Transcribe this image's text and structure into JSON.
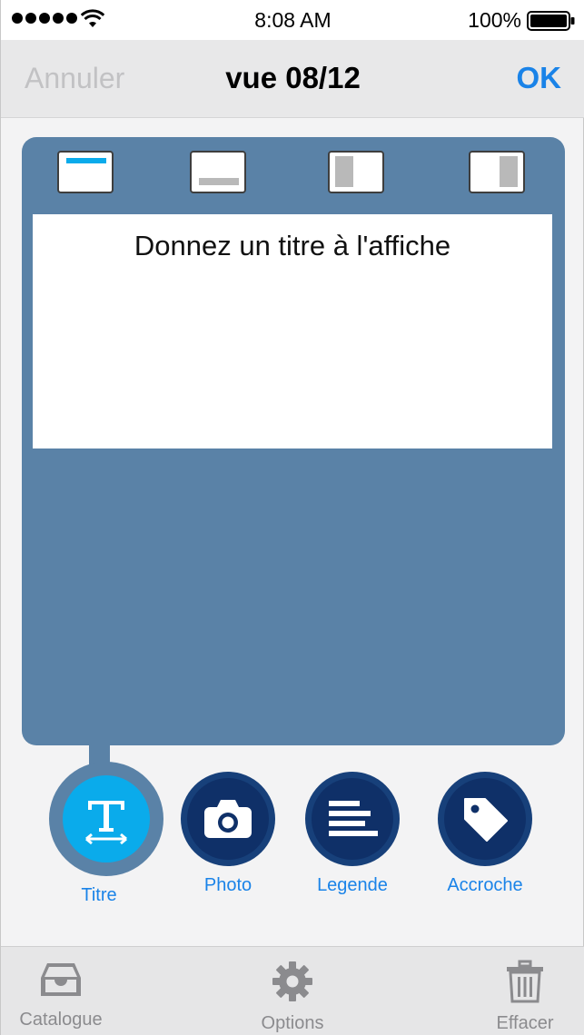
{
  "status_bar": {
    "time": "8:08 AM",
    "battery_percent": "100%",
    "signal_bars": 5,
    "icons": [
      "signal-dots-icon",
      "wifi-icon",
      "battery-icon"
    ]
  },
  "nav": {
    "cancel_label": "Annuler",
    "title": "vue 08/12",
    "ok_label": "OK"
  },
  "layout_options": [
    {
      "name": "layout-title-top-icon",
      "selected": true
    },
    {
      "name": "layout-title-bottom-icon",
      "selected": false
    },
    {
      "name": "layout-photo-left-icon",
      "selected": false
    },
    {
      "name": "layout-photo-right-icon",
      "selected": false
    }
  ],
  "poster": {
    "title_text": "Donnez un titre à l'affiche"
  },
  "tools": [
    {
      "label": "Titre",
      "icon": "text-resize-icon",
      "active": true
    },
    {
      "label": "Photo",
      "icon": "camera-icon",
      "active": false
    },
    {
      "label": "Legende",
      "icon": "paragraph-lines-icon",
      "active": false
    },
    {
      "label": "Accroche",
      "icon": "tag-icon",
      "active": false
    }
  ],
  "tabs": [
    {
      "label": "Catalogue",
      "icon": "inbox-tray-icon"
    },
    {
      "label": "Options",
      "icon": "gear-icon"
    },
    {
      "label": "Effacer",
      "icon": "trash-icon"
    }
  ],
  "colors": {
    "accent": "#1a83e8",
    "panel": "#5a82a7",
    "tool_circle": "#0f3068",
    "tool_active": "#0aabeb",
    "layout_highlight": "#0aabeb",
    "layout_placeholder": "#b9b9b9",
    "tab_icon": "#8b8b8e"
  }
}
